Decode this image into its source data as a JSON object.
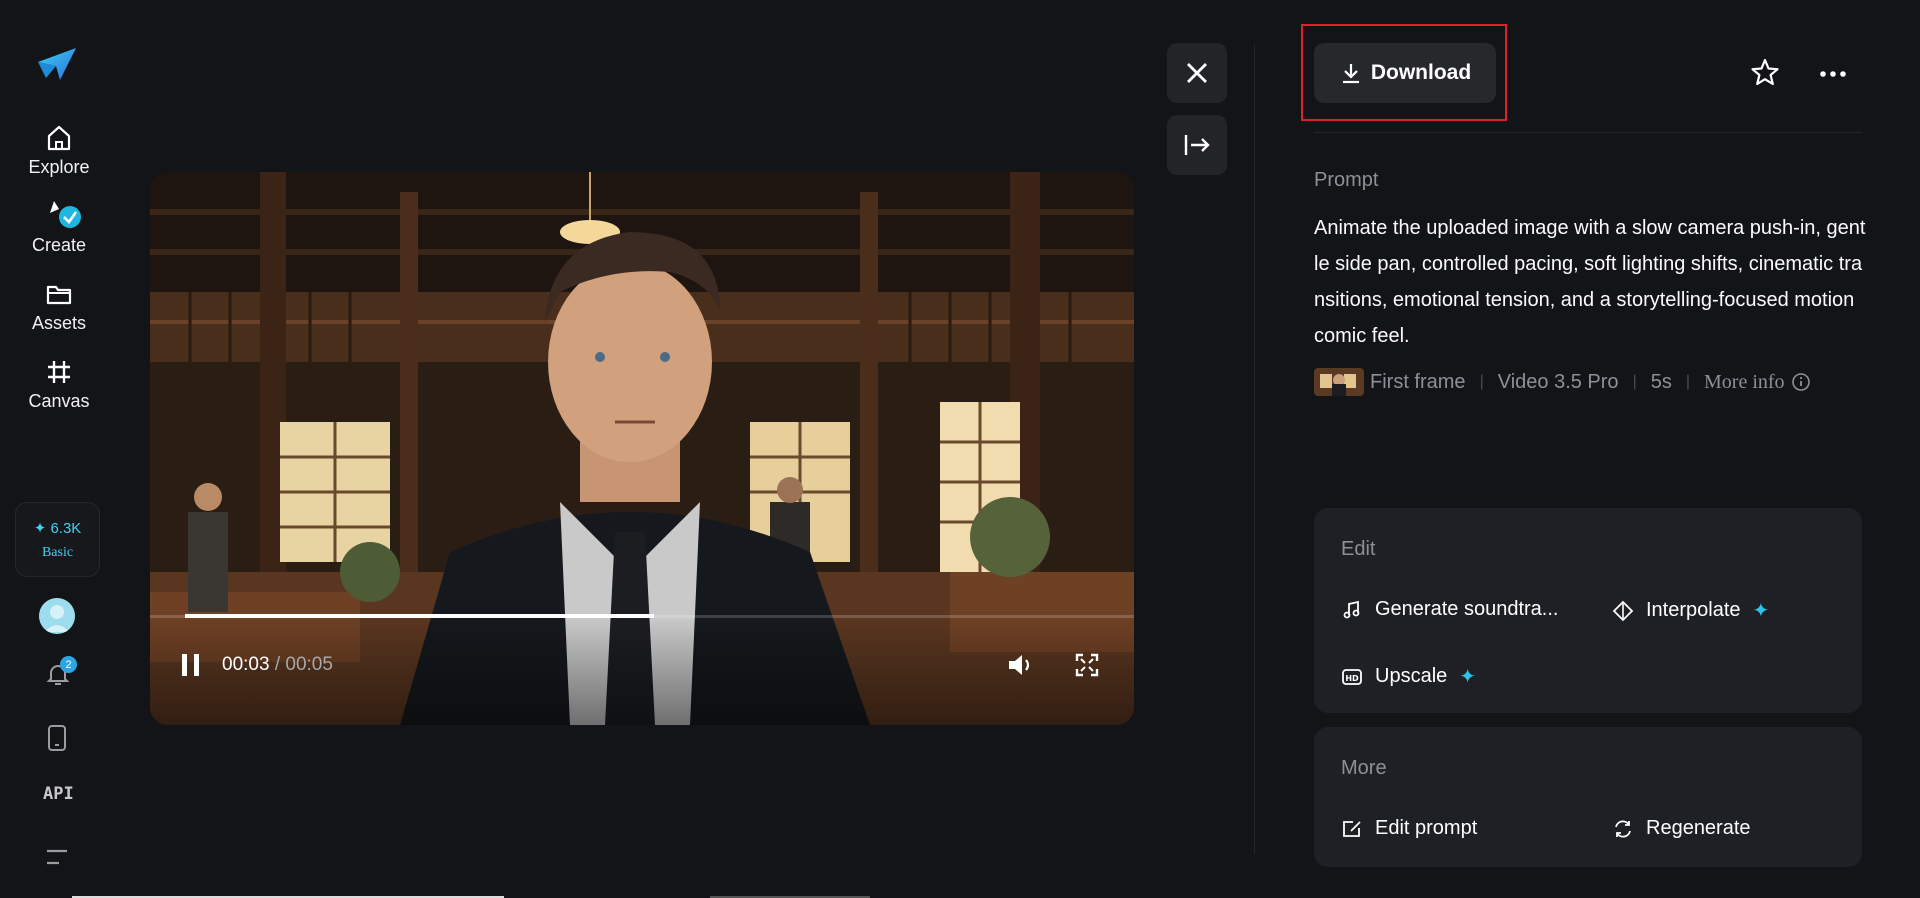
{
  "sidebar": {
    "nav": [
      {
        "label": "Explore",
        "icon": "home-icon"
      },
      {
        "label": "Create",
        "icon": "create-icon"
      },
      {
        "label": "Assets",
        "icon": "folder-icon"
      },
      {
        "label": "Canvas",
        "icon": "canvas-icon"
      }
    ],
    "credits": {
      "amount": "✦ 6.3K",
      "plan": "Basic"
    },
    "notifications_count": "2",
    "api_label": "API"
  },
  "video": {
    "current_time": "00:03",
    "time_separator": " / ",
    "total_time": "00:05",
    "progress": 0.6,
    "state": "playing"
  },
  "panel": {
    "download_label": "Download",
    "prompt_label": "Prompt",
    "prompt_text": "Animate the uploaded image with a slow camera push-in, gentle side pan, controlled pacing, soft lighting shifts, cinematic transitions, emotional tension, and a storytelling-focused motion comic feel.",
    "meta": {
      "frame": "First frame",
      "model": "Video 3.5 Pro",
      "duration": "5s",
      "more_info": "More info"
    },
    "edit": {
      "title": "Edit",
      "soundtrack": "Generate soundtra...",
      "interpolate": "Interpolate",
      "upscale": "Upscale"
    },
    "more": {
      "title": "More",
      "edit_prompt": "Edit prompt",
      "regenerate": "Regenerate"
    }
  },
  "colors": {
    "background": "#131417",
    "accent": "#2ec4ea",
    "highlight_box": "#e0202a",
    "card": "#1e2025"
  }
}
